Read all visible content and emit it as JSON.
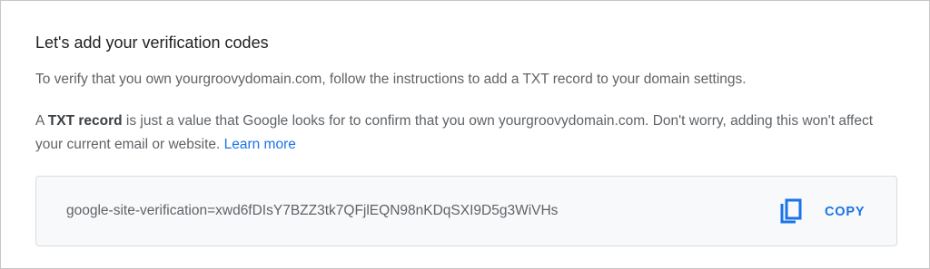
{
  "card": {
    "title": "Let's add your verification codes",
    "instructions": "To verify that you own yourgroovydomain.com, follow the instructions to add a TXT record to your domain settings.",
    "explanation": {
      "prefix": "A ",
      "bold_term": "TXT record",
      "body": " is just a value that Google looks for to confirm that you own yourgroovydomain.com. Don't worry, adding this won't affect your current email or website. ",
      "link_label": "Learn more"
    },
    "verification": {
      "code": "google-site-verification=xwd6fDIsY7BZZ3tk7QFjlEQN98nKDqSXI9D5g3WiVHs",
      "copy_label": "COPY",
      "copy_icon": "copy-icon"
    }
  },
  "colors": {
    "accent": "#1a73e8",
    "body_text": "#5f6368",
    "title_text": "#202124",
    "code_background": "#f8f9fa",
    "border": "#dadce0"
  }
}
